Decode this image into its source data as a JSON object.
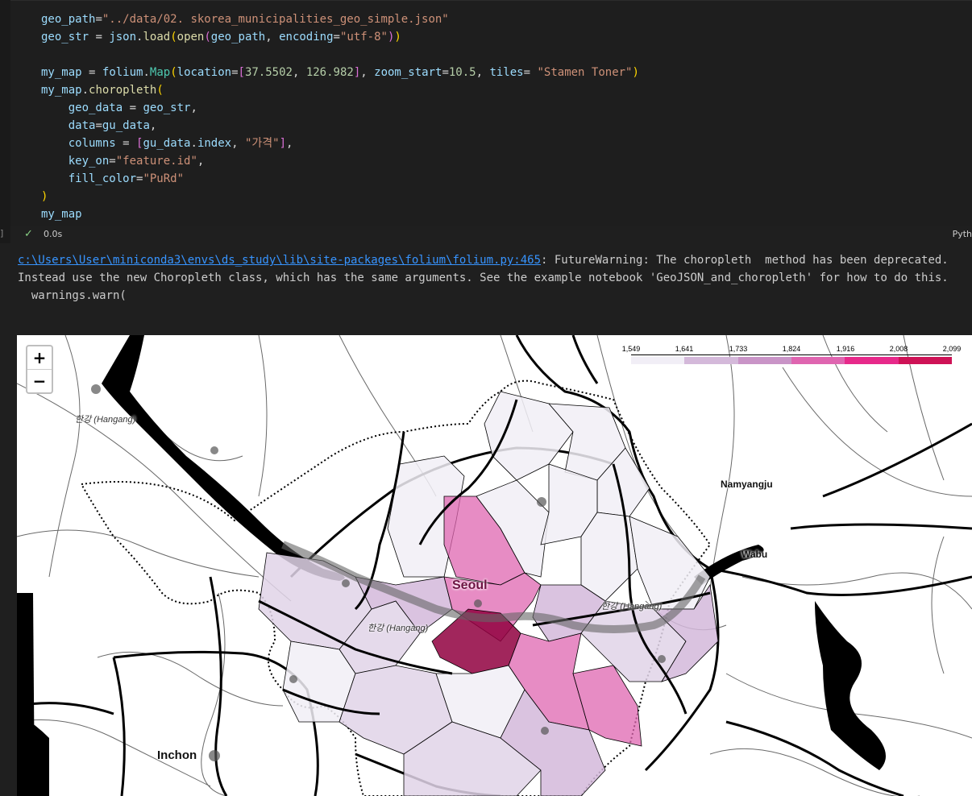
{
  "code_lines": [
    "geo_path=\"../data/02. skorea_municipalities_geo_simple.json\"",
    "geo_str = json.load(open(geo_path, encoding=\"utf-8\"))",
    "",
    "my_map = folium.Map(location=[37.5502, 126.982], zoom_start=10.5, tiles= \"Stamen Toner\")",
    "my_map.choropleth(",
    "    geo_data = geo_str,",
    "    data=gu_data,",
    "    columns = [gu_data.index, \"가격\"],",
    "    key_on=\"feature.id\",",
    "    fill_color=\"PuRd\"",
    ")",
    "my_map"
  ],
  "cell_status": {
    "check_icon": "check-icon",
    "time": "0.0s",
    "language": "Pyth",
    "bracket": "]"
  },
  "warning": {
    "path": "c:\\Users\\User\\miniconda3\\envs\\ds_study\\lib\\site-packages\\folium\\folium.py:465",
    "message": ": FutureWarning: The choropleth  method has been deprecated. Instead use the new Choropleth class, which has the same arguments. See the example notebook 'GeoJSON_and_choropleth' for how to do this.",
    "line2": "  warnings.warn("
  },
  "map": {
    "zoom_in": "+",
    "zoom_out": "−",
    "legend_ticks": [
      "1,549",
      "1,641",
      "1,733",
      "1,824",
      "1,916",
      "2,008",
      "2,099"
    ],
    "legend_colors": [
      "#f1eef6",
      "#d4b9da",
      "#c994c7",
      "#df65b0",
      "#e7298a",
      "#ce1256",
      "#91003f"
    ],
    "labels": {
      "seoul": "Seoul",
      "incheon": "Inchon",
      "namyangju": "Namyangju",
      "wabu": "Wabu",
      "hangang_nw": "한강 (Hangang)",
      "hangang_center": "한강 (Hangang)",
      "hangang_east": "한강 (Hangang)"
    }
  }
}
